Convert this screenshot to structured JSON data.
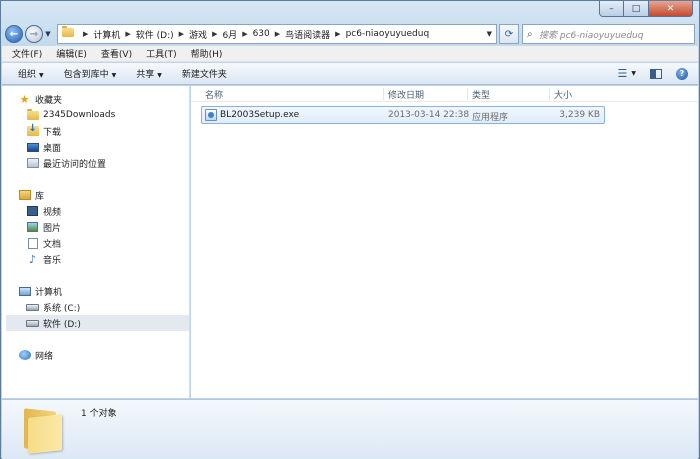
{
  "window": {
    "caption": {
      "minimize": "–",
      "maximize": "□",
      "close": "✕"
    }
  },
  "address": {
    "crumbs": [
      "计算机",
      "软件 (D:)",
      "游戏",
      "6月",
      "630",
      "鸟语阅读器",
      "pc6-niaoyuyueduq"
    ],
    "search_placeholder": "搜索 pc6-niaoyuyueduq"
  },
  "menu": [
    "文件(F)",
    "编辑(E)",
    "查看(V)",
    "工具(T)",
    "帮助(H)"
  ],
  "commands": [
    "组织",
    "包含到库中",
    "共享",
    "新建文件夹"
  ],
  "nav": {
    "favorites": "收藏夹",
    "fav_items": [
      "2345Downloads",
      "下载",
      "桌面",
      "最近访问的位置"
    ],
    "libraries": "库",
    "lib_items": [
      "视频",
      "图片",
      "文档",
      "音乐"
    ],
    "computer": "计算机",
    "drives": [
      "系统 (C:)",
      "软件 (D:)"
    ],
    "network": "网络"
  },
  "columns": {
    "name": "名称",
    "modified": "修改日期",
    "type": "类型",
    "size": "大小"
  },
  "files": [
    {
      "name": "BL2003Setup.exe",
      "modified": "2013-03-14 22:38",
      "type": "应用程序",
      "size": "3,239 KB"
    }
  ],
  "details": {
    "count": "1 个对象"
  },
  "colors": {
    "selection": "#dfecf9",
    "accent": "#1f5fb0"
  }
}
